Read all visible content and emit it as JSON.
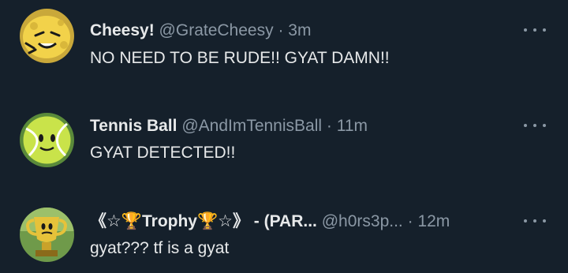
{
  "tweets": [
    {
      "name": "Cheesy!",
      "handle": "@GrateCheesy",
      "separator": "·",
      "time": "3m",
      "text": "NO NEED TO BE RUDE!! GYAT DAMN!!",
      "avatar_icon": "cheese-character-icon"
    },
    {
      "name": "Tennis Ball",
      "handle": "@AndImTennisBall",
      "separator": "·",
      "time": "11m",
      "text": "GYAT DETECTED!!",
      "avatar_icon": "tennis-ball-character-icon"
    },
    {
      "name": "《☆🏆Trophy🏆☆》 - (PAR...",
      "handle": "@h0rs3p...",
      "separator": "·",
      "time": "12m",
      "text": "gyat??? tf is a gyat",
      "avatar_icon": "trophy-character-icon"
    }
  ],
  "colors": {
    "background": "#15202b",
    "primary_text": "#e7e9ea",
    "secondary_text": "#8b98a5"
  }
}
